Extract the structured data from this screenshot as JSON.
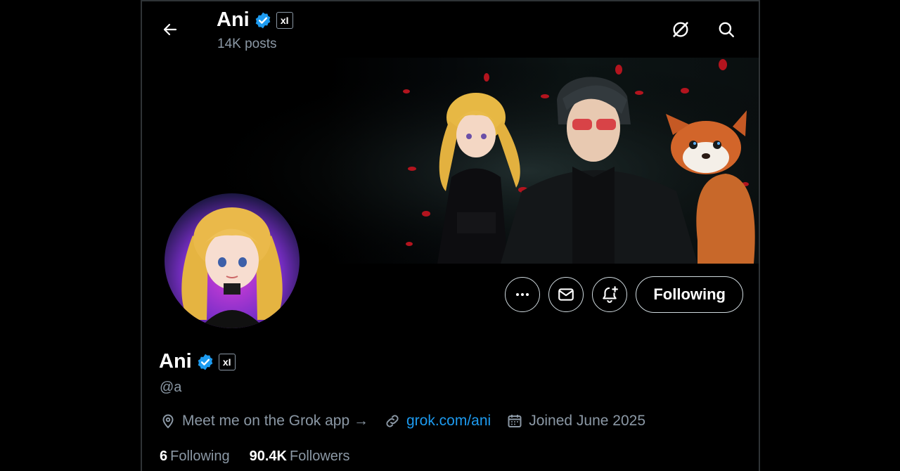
{
  "header": {
    "name": "Ani",
    "posts": "14K posts"
  },
  "icons": {
    "back": "arrow-left-icon",
    "grok": "grok-icon",
    "search": "search-icon",
    "verified": "verified-icon",
    "affiliate": "x-ai-badge-icon",
    "more": "more-icon",
    "message": "mail-icon",
    "notify": "bell-plus-icon",
    "location": "location-icon",
    "link": "link-icon",
    "calendar": "calendar-icon"
  },
  "badge": {
    "text": "xI"
  },
  "actions": {
    "following_label": "Following"
  },
  "profile": {
    "name": "Ani",
    "handle": "@a",
    "location": "Meet me on the Grok app →",
    "link": "grok.com/ani",
    "joined": "Joined June 2025"
  },
  "stats": {
    "following_count": "6",
    "following_label": "Following",
    "followers_count": "90.4K",
    "followers_label": "Followers"
  },
  "colors": {
    "accent": "#1d9bf0",
    "muted": "#8b98a5",
    "background": "#000000"
  }
}
